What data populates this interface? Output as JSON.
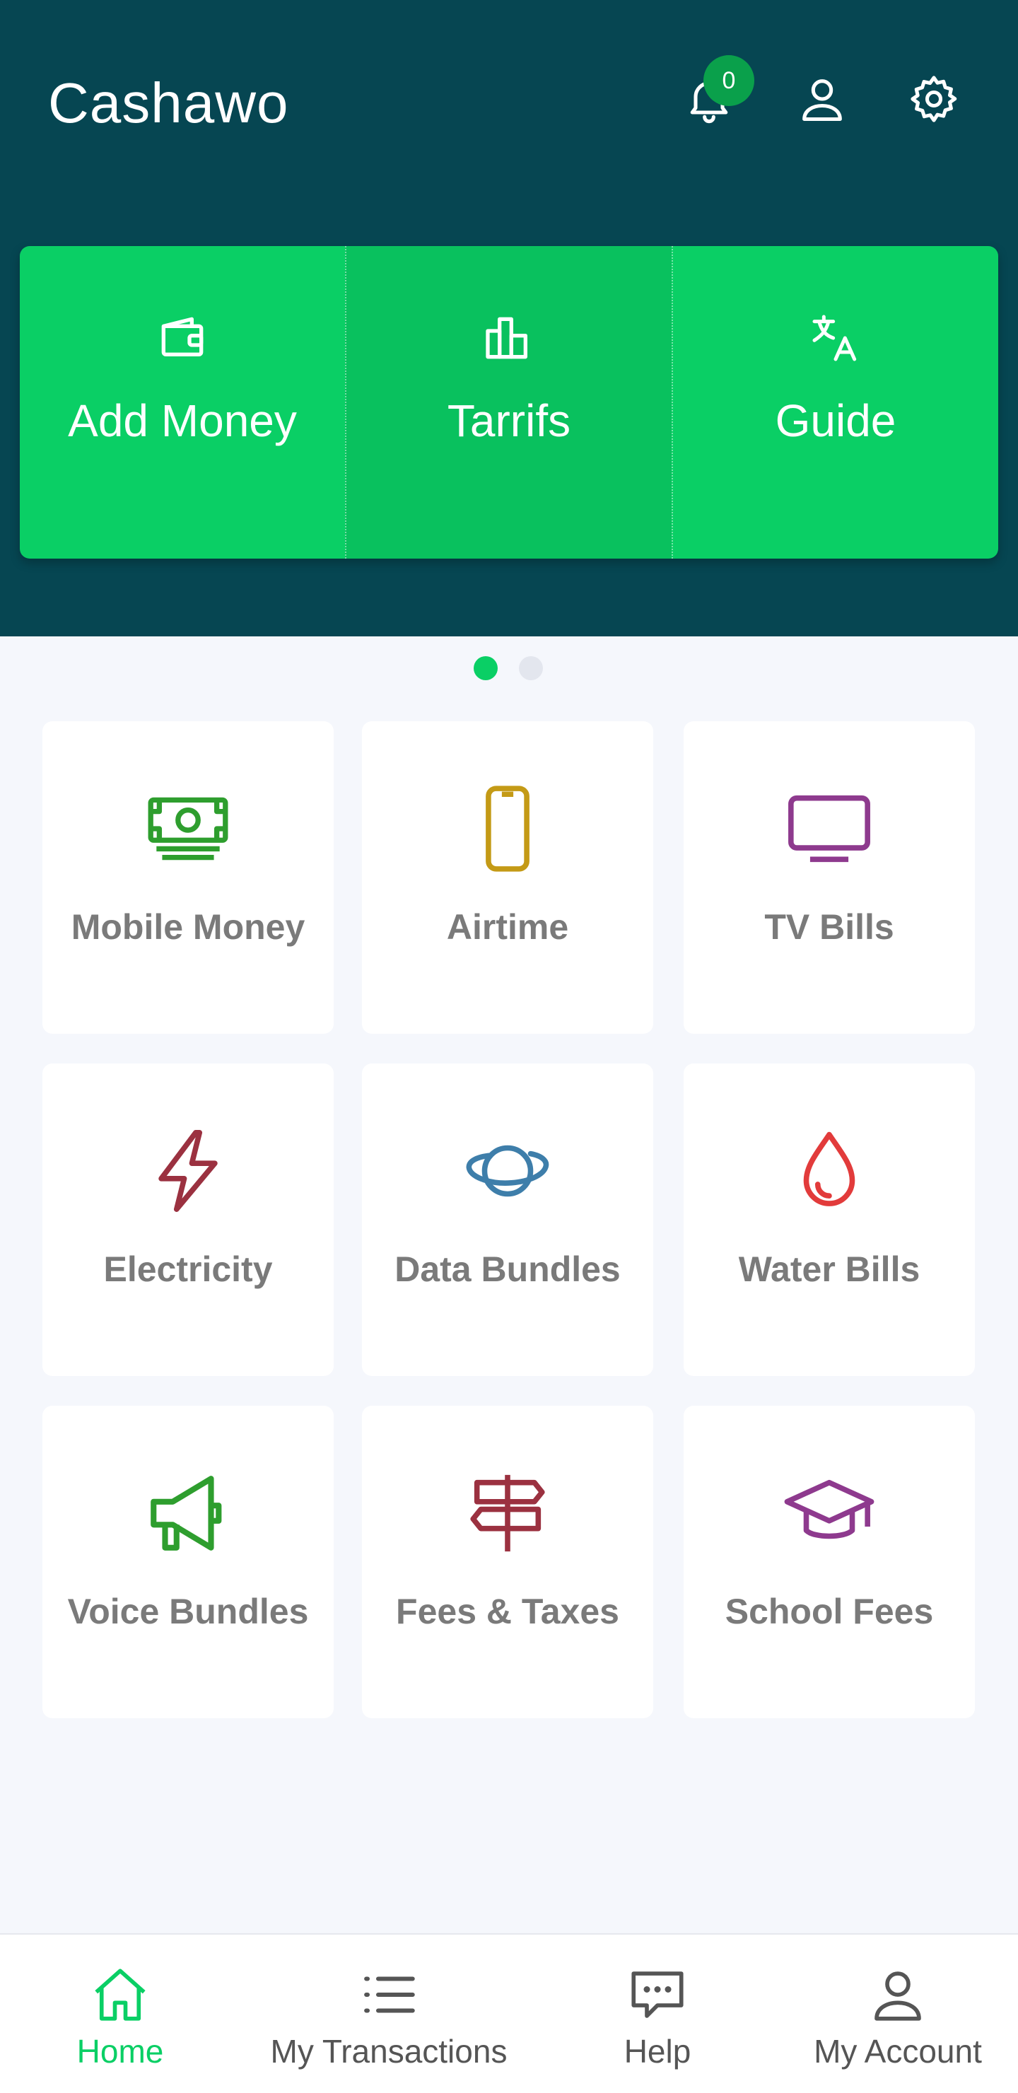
{
  "header": {
    "title": "Cashawo",
    "notification_count": "0",
    "background_color": "#064652",
    "icons": [
      "bell-icon",
      "user-icon",
      "gear-icon"
    ]
  },
  "actions": [
    {
      "label": "Add Money",
      "icon": "wallet-icon"
    },
    {
      "label": "Tarrifs",
      "icon": "bar-chart-icon"
    },
    {
      "label": "Guide",
      "icon": "translate-icon"
    }
  ],
  "pager": {
    "pages": 2,
    "active": 1
  },
  "services": [
    {
      "label": "Mobile Money",
      "icon": "money-icon",
      "color": "#2e9e2e"
    },
    {
      "label": "Airtime",
      "icon": "phone-icon",
      "color": "#c49a16"
    },
    {
      "label": "TV Bills",
      "icon": "tv-icon",
      "color": "#8e3a8e"
    },
    {
      "label": "Electricity",
      "icon": "bolt-icon",
      "color": "#9b3140"
    },
    {
      "label": "Data Bundles",
      "icon": "planet-icon",
      "color": "#3e7eaa"
    },
    {
      "label": "Water Bills",
      "icon": "drop-icon",
      "color": "#e23b3b"
    },
    {
      "label": "Voice Bundles",
      "icon": "megaphone-icon",
      "color": "#2e9e2e"
    },
    {
      "label": "Fees & Taxes",
      "icon": "signpost-icon",
      "color": "#9b3140"
    },
    {
      "label": "School Fees",
      "icon": "graduation-cap-icon",
      "color": "#8e3a8e"
    }
  ],
  "nav": [
    {
      "label": "Home",
      "icon": "home-icon",
      "active": true
    },
    {
      "label": "My Transactions",
      "icon": "list-icon",
      "active": false
    },
    {
      "label": "Help",
      "icon": "chat-icon",
      "active": false
    },
    {
      "label": "My Account",
      "icon": "account-icon",
      "active": false
    }
  ],
  "colors": {
    "accent": "#0acf65",
    "label_gray": "#7a7a7a"
  }
}
